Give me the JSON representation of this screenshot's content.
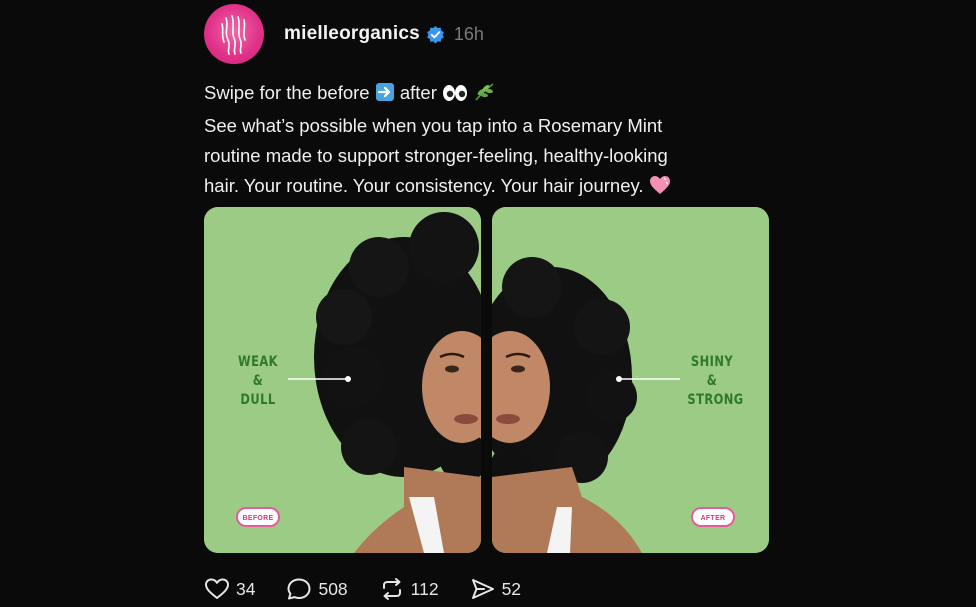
{
  "post": {
    "username": "mielleorganics",
    "time": "16h",
    "caption": {
      "line1_start": "Swipe for the before",
      "line1_mid": "after",
      "line2": "See what’s possible when you tap into a Rosemary Mint",
      "line3": "routine made to support stronger-feeling, healthy-looking",
      "line4": "hair. Your routine. Your consistency. Your hair journey."
    },
    "emoji_names": [
      "arrow-right-emoji",
      "eyes-emoji",
      "herb-emoji",
      "heart-emoji"
    ]
  },
  "media": {
    "left": {
      "label_lines": [
        "WEAK",
        "&",
        "DULL"
      ],
      "tag": "BEFORE"
    },
    "right": {
      "label_lines": [
        "SHINY",
        "&",
        "STRONG"
      ],
      "tag": "AFTER"
    }
  },
  "actions": {
    "likes": "34",
    "comments": "508",
    "reposts": "112",
    "shares": "52"
  },
  "colors": {
    "background": "#0a0a0a",
    "brand_pink": "#e2338a",
    "verified_blue": "#3897f0",
    "panel_green": "#9ccb85",
    "label_green": "#2f7a2a"
  }
}
